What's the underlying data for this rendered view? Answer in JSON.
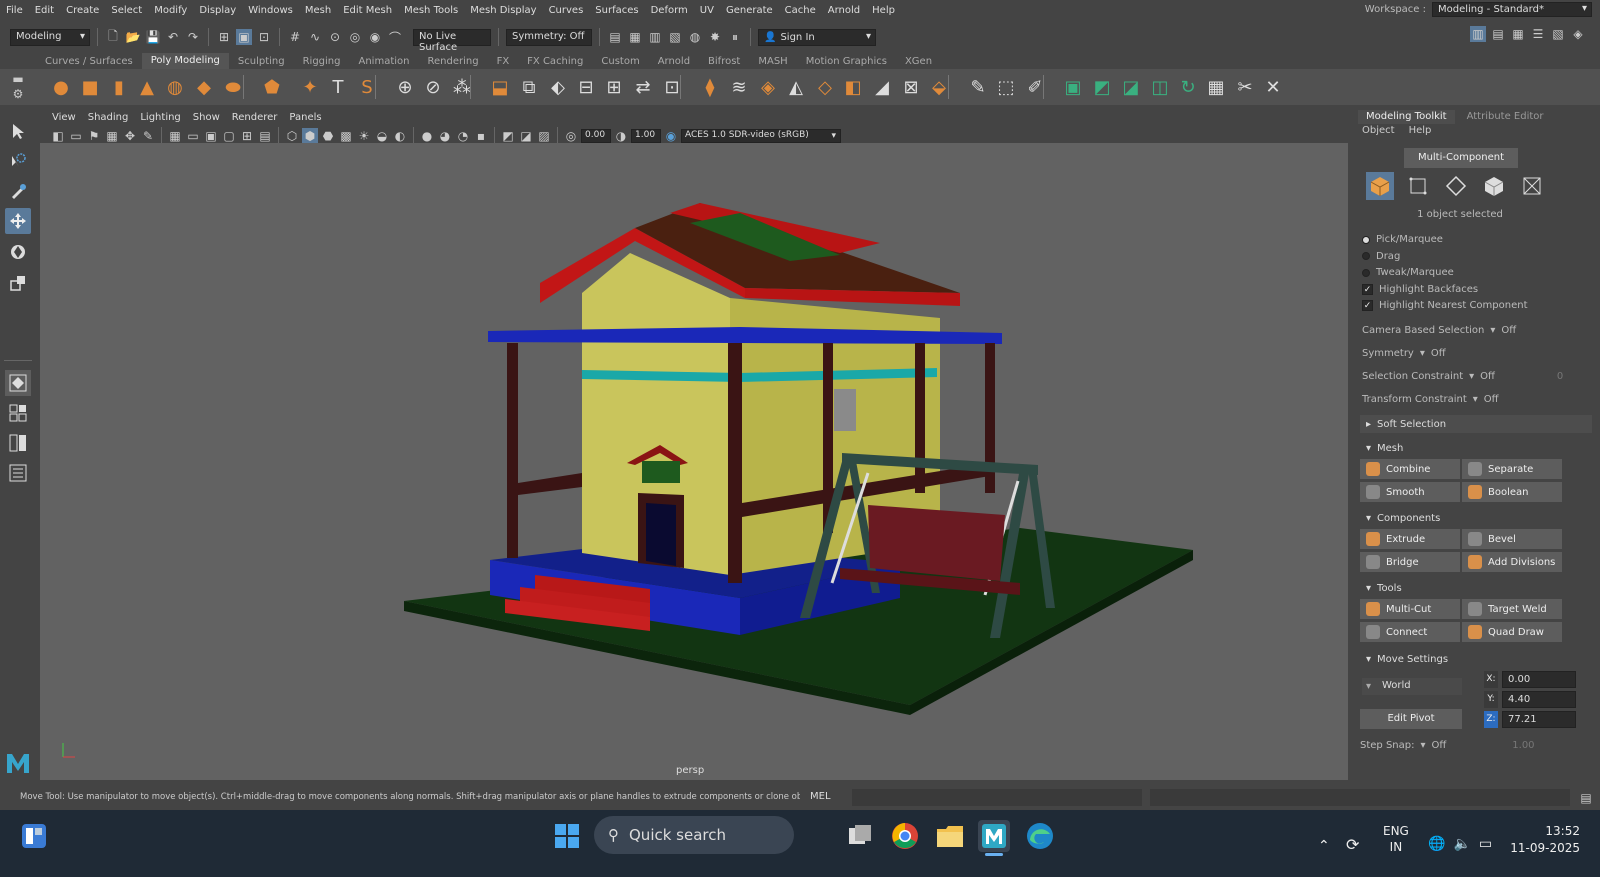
{
  "menubar": {
    "items": [
      "File",
      "Edit",
      "Create",
      "Select",
      "Modify",
      "Display",
      "Windows",
      "Mesh",
      "Edit Mesh",
      "Mesh Tools",
      "Mesh Display",
      "Curves",
      "Surfaces",
      "Deform",
      "UV",
      "Generate",
      "Cache",
      "Arnold",
      "Help"
    ],
    "workspace_label": "Workspace :",
    "workspace_value": "Modeling - Standard*"
  },
  "statusline": {
    "mode": "Modeling",
    "live_surface": "No Live Surface",
    "symmetry": "Symmetry: Off",
    "sign_in": "Sign In"
  },
  "shelf": {
    "tabs": [
      "Curves / Surfaces",
      "Poly Modeling",
      "Sculpting",
      "Rigging",
      "Animation",
      "Rendering",
      "FX",
      "FX Caching",
      "Custom",
      "Arnold",
      "Bifrost",
      "MASH",
      "Motion Graphics",
      "XGen"
    ],
    "active_tab": "Poly Modeling"
  },
  "viewport": {
    "menus": [
      "View",
      "Shading",
      "Lighting",
      "Show",
      "Renderer",
      "Panels"
    ],
    "exposure": "0.00",
    "gamma": "1.00",
    "colorspace": "ACES 1.0 SDR-video (sRGB)",
    "camera": "persp"
  },
  "toolkit": {
    "tabs": [
      "Modeling Toolkit",
      "Attribute Editor"
    ],
    "menus": [
      "Object",
      "Help"
    ],
    "mode_button": "Multi-Component",
    "selection_status": "1 object selected",
    "options": [
      {
        "label": "Pick/Marquee",
        "type": "radio",
        "on": true
      },
      {
        "label": "Drag",
        "type": "radio",
        "on": false
      },
      {
        "label": "Tweak/Marquee",
        "type": "radio",
        "on": false
      },
      {
        "label": "Highlight Backfaces",
        "type": "check",
        "on": true
      },
      {
        "label": "Highlight Nearest Component",
        "type": "check",
        "on": true
      }
    ],
    "dropdowns": [
      {
        "label": "Camera Based Selection",
        "value": "Off"
      },
      {
        "label": "Symmetry",
        "value": "Off"
      },
      {
        "label": "Selection Constraint",
        "value": "Off",
        "extra": "0"
      },
      {
        "label": "Transform Constraint",
        "value": "Off"
      }
    ],
    "soft_selection": "Soft Selection",
    "sections": [
      {
        "title": "Mesh",
        "buttons": [
          "Combine",
          "Separate",
          "Smooth",
          "Boolean"
        ]
      },
      {
        "title": "Components",
        "buttons": [
          "Extrude",
          "Bevel",
          "Bridge",
          "Add Divisions"
        ]
      },
      {
        "title": "Tools",
        "buttons": [
          "Multi-Cut",
          "Target Weld",
          "Connect",
          "Quad Draw"
        ]
      }
    ],
    "move_settings": {
      "title": "Move Settings",
      "space": "World",
      "edit_pivot": "Edit Pivot",
      "x_label": "X:",
      "x": "0.00",
      "y_label": "Y:",
      "y": "4.40",
      "z_label": "Z:",
      "z": "77.21",
      "step_snap_label": "Step Snap:",
      "step_snap": "Off",
      "step_value": "1.00"
    }
  },
  "helpline": "Move Tool: Use manipulator to move object(s). Ctrl+middle-drag to move components along normals. Shift+drag manipulator axis or plane handles to extrude components or clone objects. Ctrl+Shift+drag to con",
  "cmd_lang": "MEL",
  "taskbar": {
    "search": "Quick search",
    "lang1": "ENG",
    "lang2": "IN",
    "time": "13:52",
    "date": "11-09-2025"
  }
}
